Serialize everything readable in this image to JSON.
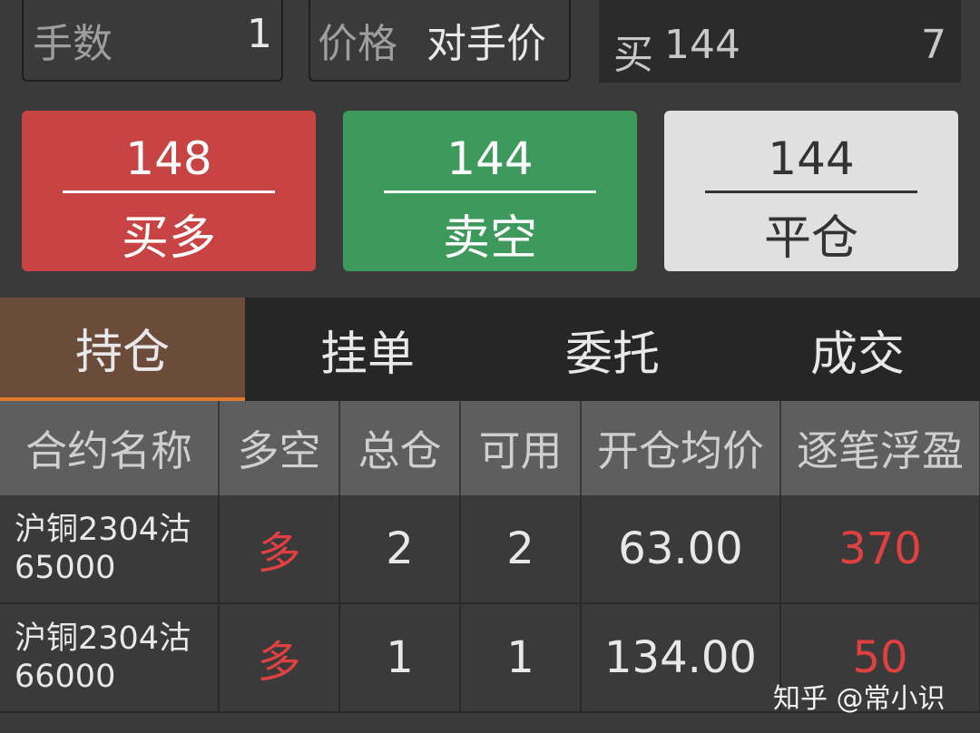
{
  "order_form": {
    "qty_label": "手数",
    "qty_value": "1",
    "price_label": "价格",
    "price_value": "对手价",
    "quote_side": "买",
    "quote_price": "144",
    "quote_volume": "7"
  },
  "buttons": {
    "buy_long": {
      "price": "148",
      "label": "买多",
      "color": "#c84444"
    },
    "sell_short": {
      "price": "144",
      "label": "卖空",
      "color": "#3d9a5c"
    },
    "close_position": {
      "price": "144",
      "label": "平仓",
      "color": "#e0e0e0"
    }
  },
  "tabs": [
    {
      "label": "持仓",
      "active": true
    },
    {
      "label": "挂单",
      "active": false
    },
    {
      "label": "委托",
      "active": false
    },
    {
      "label": "成交",
      "active": false
    }
  ],
  "positions_table": {
    "headers": [
      "合约名称",
      "多空",
      "总仓",
      "可用",
      "开仓均价",
      "逐笔浮盈"
    ],
    "rows": [
      {
        "name_line1": "沪铜2304沽",
        "name_line2": "65000",
        "side": "多",
        "total": "2",
        "available": "2",
        "avg_open_price": "63.00",
        "float_pnl": "370"
      },
      {
        "name_line1": "沪铜2304沽",
        "name_line2": "66000",
        "side": "多",
        "total": "1",
        "available": "1",
        "avg_open_price": "134.00",
        "float_pnl": "50"
      }
    ]
  },
  "watermark": "知乎 @常小识"
}
